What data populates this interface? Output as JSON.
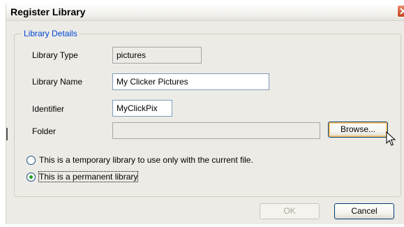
{
  "window": {
    "title": "Register Library"
  },
  "group": {
    "label": "Library Details"
  },
  "fields": {
    "library_type": {
      "label": "Library Type",
      "value": "pictures"
    },
    "library_name": {
      "label": "Library Name",
      "value": "My Clicker Pictures"
    },
    "identifier": {
      "label": "Identifier",
      "value": "MyClickPix"
    },
    "folder": {
      "label": "Folder",
      "value": ""
    }
  },
  "buttons": {
    "browse": "Browse...",
    "ok": "OK",
    "cancel": "Cancel"
  },
  "radios": {
    "temporary": {
      "label": "This is a temporary library to use only with the current file.",
      "selected": false
    },
    "permanent": {
      "label": "This is a permanent library",
      "selected": true
    }
  },
  "colors": {
    "dialog_bg": "#ecebe6",
    "group_label": "#0046d5",
    "button_border": "#003c74",
    "focus_highlight": "#f7c46b",
    "radio_selected": "#21a121",
    "close_button": "#c8421c"
  },
  "icons": {
    "close": "close-icon",
    "cursor": "mouse-pointer-icon"
  }
}
